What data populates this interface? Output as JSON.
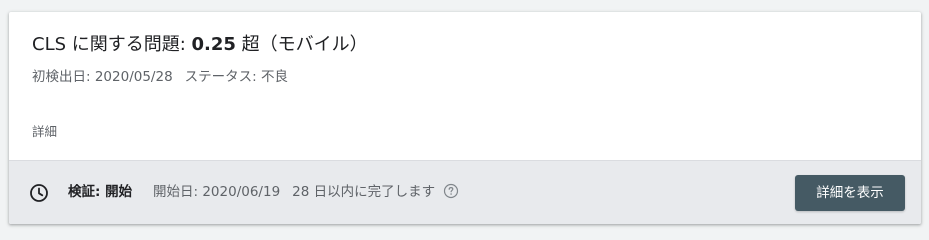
{
  "issue": {
    "title_prefix": "CLS に関する問題: ",
    "title_value": "0.25",
    "title_suffix": " 超（モバイル）",
    "first_detected_label": "初検出日: ",
    "first_detected_date": "2020/05/28",
    "status_label": "ステータス: ",
    "status_value": "不良",
    "details_label": "詳細"
  },
  "validation": {
    "label": "検証: 開始",
    "start_label": "開始日: ",
    "start_date": "2020/06/19",
    "completion_note": "28 日以内に完了します",
    "clock_icon": "clock-icon",
    "help_icon": "help-circle-icon",
    "details_button_label": "詳細を表示"
  },
  "colors": {
    "accent_button": "#455a64",
    "bar_background": "#e8eaed"
  }
}
